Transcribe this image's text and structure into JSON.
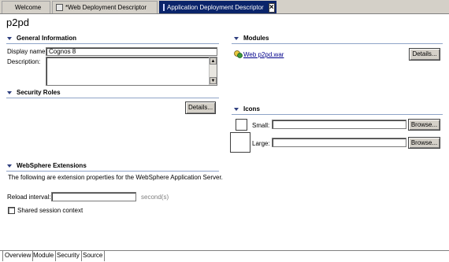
{
  "tabs": [
    {
      "label": "Welcome"
    },
    {
      "label": "*Web Deployment Descriptor"
    },
    {
      "label": "Application Deployment Descriptor",
      "active": true
    }
  ],
  "page": {
    "title": "p2pd"
  },
  "general": {
    "heading": "General Information",
    "display_name_label": "Display name:",
    "display_name_value": "Cognos 8",
    "description_label": "Description:",
    "description_value": ""
  },
  "security": {
    "heading": "Security Roles",
    "details_label": "Details..."
  },
  "websphere": {
    "heading": "WebSphere Extensions",
    "description": "The following are extension properties for the WebSphere Application Server.",
    "reload_label": "Reload interval:",
    "reload_value": "",
    "reload_unit": "second(s)",
    "shared_session_label": "Shared session context",
    "shared_session_checked": false
  },
  "modules": {
    "heading": "Modules",
    "items": [
      {
        "label": "Web p2pd.war"
      }
    ],
    "details_label": "Details..."
  },
  "icons": {
    "heading": "Icons",
    "small_label": "Small:",
    "small_value": "",
    "large_label": "Large:",
    "large_value": "",
    "browse_label": "Browse..."
  },
  "bottom_tabs": [
    {
      "label": "Overview",
      "active": true
    },
    {
      "label": "Module"
    },
    {
      "label": "Security"
    },
    {
      "label": "Source"
    }
  ],
  "colors": {
    "active_tab": "#0a246a",
    "section_rule": "#8fa4c8",
    "link": "#00008b"
  }
}
